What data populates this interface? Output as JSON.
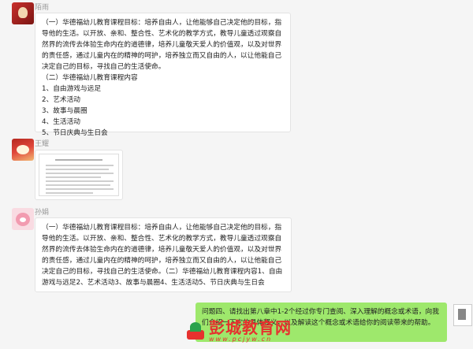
{
  "messages": [
    {
      "sender": "陌雨",
      "text": "（一）华德福幼儿教育课程目标：培养自由人，让他能够自己决定他的目标，指导他的生活。以开放、亲和、整合性、艺术化的教学方式，教导儿童透过观察自然界的流传去体验生命内在的道德律，培养儿童敬天爱人的价值观，以及对世界的责任感，通过儿童内在的精神的呵护，培养独立而又自由的人，以让他能自己决定自己的目标，寻找自己的生活使命。\n（二）华德福幼儿教育课程内容\n1、自由游戏与远足\n2、艺术活动\n3、故事与晨圈\n4、生活活动\n5、节日庆典与生日会"
    },
    {
      "sender": "王耀"
    },
    {
      "sender": "孙娟",
      "text": "（一）华德福幼儿教育课程目标：培养自由人，让他能够自己决定他的目标，指导他的生活。以开放、亲和、整合性、艺术化的教学方式，教导儿童透过观察自然界的流传去体验生命内在的道德律，培养儿童敬天爱人的价值观，以及对世界的责任感，通过儿童内在的精神的呵护，培养独立而又自由的人，以让他能自己决定自己的目标，寻找自己的生活使命。（二）华德福幼儿教育课程内容1、自由游戏与远足2、艺术活动3、故事与晨圈4、生活活动5、节日庆典与生日会"
    }
  ],
  "outgoing": {
    "text": "问题四、请找出第八章中1-2个经过你专门查阅、深入理解的概念或术语，向我们介绍一下它的具体释义，以及解读这个概念或术语给你的阅读带来的帮助。"
  },
  "watermark": {
    "name": "彭城教育网",
    "url": "www.pcjyw.cn"
  },
  "colors": {
    "background": "#f5f5f5",
    "outgoing_bubble": "#9ee86c",
    "watermark": "#e6312e"
  }
}
